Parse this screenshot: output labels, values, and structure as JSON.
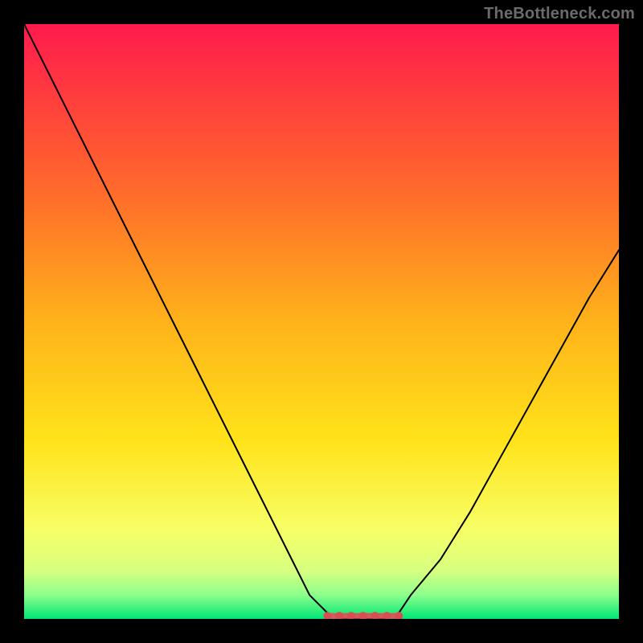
{
  "watermark": {
    "text": "TheBottleneck.com"
  },
  "colors": {
    "frame": "#000000",
    "curve": "#000000",
    "marker_fill": "#d84f4f",
    "marker_segment": "#d65a5a",
    "grad_top": "#ff1a4d",
    "grad_mid1": "#ff6a2b",
    "grad_mid2": "#ffb21a",
    "grad_mid3": "#ffe31a",
    "grad_low1": "#f7ff66",
    "grad_low2": "#d6ff80",
    "grad_low3": "#8cff8c",
    "grad_bottom": "#00e676"
  },
  "axes": {
    "x_range": [
      0,
      100
    ],
    "y_range": [
      0,
      100
    ],
    "grid": false,
    "tick_labels_visible": false
  },
  "chart_data": {
    "type": "line",
    "title": "",
    "xlabel": "",
    "ylabel": "",
    "xlim": [
      0,
      100
    ],
    "ylim": [
      0,
      100
    ],
    "x": [
      0,
      5,
      10,
      15,
      20,
      25,
      30,
      35,
      40,
      45,
      48,
      51,
      54,
      57,
      60,
      63,
      65,
      70,
      75,
      80,
      85,
      90,
      95,
      100
    ],
    "series": [
      {
        "name": "bottleneck-curve",
        "values": [
          100,
          90,
          80,
          70,
          60,
          50,
          40,
          30,
          20,
          10,
          4,
          1,
          0,
          0,
          0,
          1,
          4,
          10,
          18,
          27,
          36,
          45,
          54,
          62
        ]
      }
    ],
    "flat_region": {
      "x_start": 51,
      "x_end": 63,
      "y": 0.5,
      "marker_xs": [
        51,
        53,
        55,
        57,
        59,
        61,
        63
      ]
    }
  }
}
